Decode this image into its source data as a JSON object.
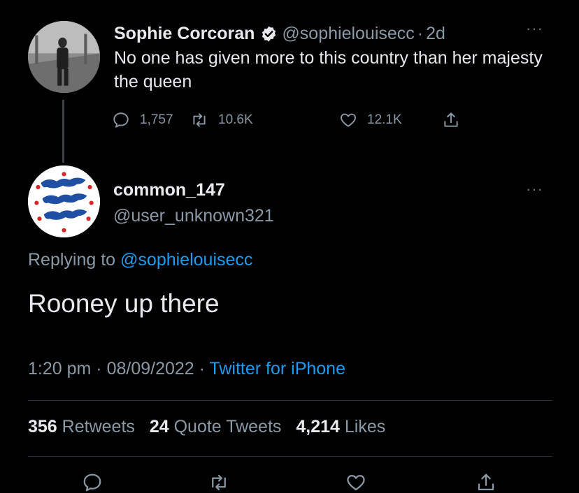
{
  "original_tweet": {
    "author_name": "Sophie Corcoran",
    "handle": "@sophielouisecc",
    "separator": "·",
    "age": "2d",
    "more": "···",
    "text": "No one has given more to this country than her majesty the queen",
    "replies": "1,757",
    "retweets": "10.6K",
    "likes": "12.1K"
  },
  "reply_tweet": {
    "author_name": "common_147",
    "handle": "@user_unknown321",
    "more": "···",
    "replying_prefix": "Replying to ",
    "replying_mention": "@sophielouisecc",
    "text": "Rooney up there",
    "time": "1:20 pm",
    "separator": " · ",
    "date": "08/09/2022",
    "source": "Twitter for iPhone",
    "stats": {
      "retweets_count": "356",
      "retweets_label": "Retweets",
      "quotes_count": "24",
      "quotes_label": "Quote Tweets",
      "likes_count": "4,214",
      "likes_label": "Likes"
    }
  },
  "icons": {
    "verified": "verified-badge-icon",
    "reply": "reply-icon",
    "retweet": "retweet-icon",
    "like": "heart-icon",
    "share": "share-icon"
  },
  "colors": {
    "background": "#000000",
    "text_primary": "#e7e9ea",
    "text_secondary": "#8b98a5",
    "link": "#1d9bf0",
    "divider": "#2f3336"
  }
}
